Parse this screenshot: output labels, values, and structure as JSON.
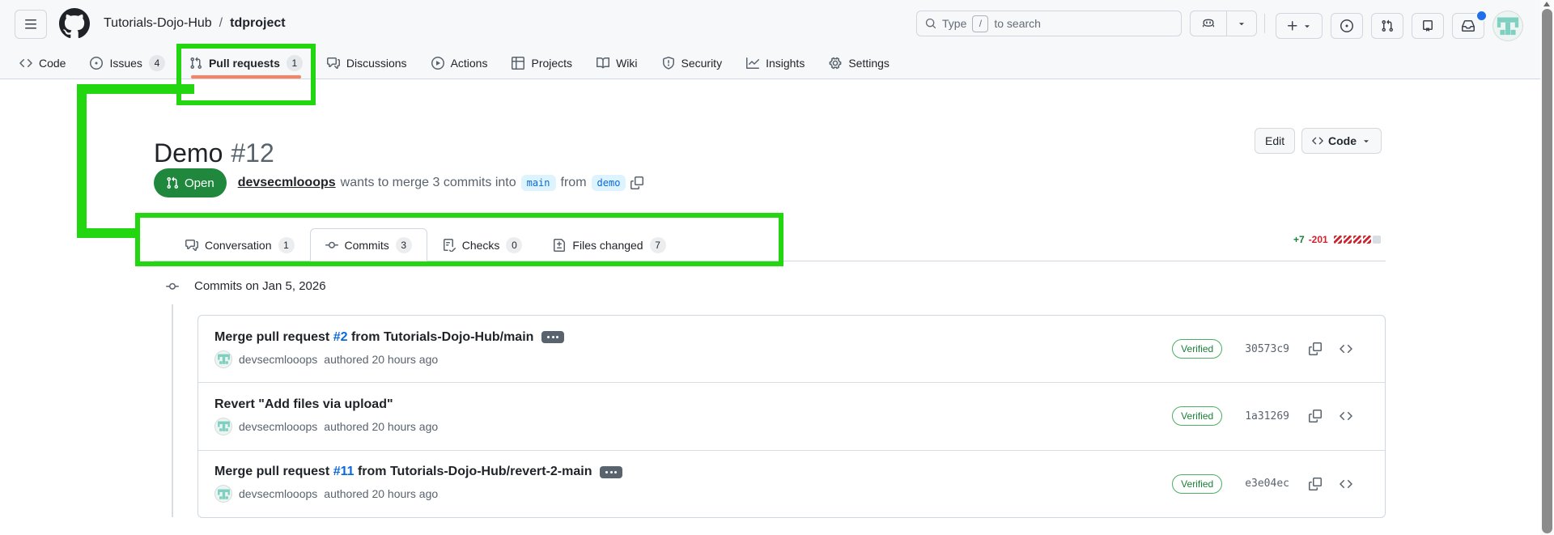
{
  "header": {
    "org": "Tutorials-Dojo-Hub",
    "separator": "/",
    "repo": "tdproject",
    "search_placeholder": {
      "prefix": "Type",
      "key": "/",
      "suffix": "to search"
    }
  },
  "repo_nav": {
    "items": [
      {
        "label": "Code"
      },
      {
        "label": "Issues",
        "count": "4"
      },
      {
        "label": "Pull requests",
        "count": "1",
        "active": true
      },
      {
        "label": "Discussions"
      },
      {
        "label": "Actions"
      },
      {
        "label": "Projects"
      },
      {
        "label": "Wiki"
      },
      {
        "label": "Security"
      },
      {
        "label": "Insights"
      },
      {
        "label": "Settings"
      }
    ]
  },
  "pr_header": {
    "title": "Demo",
    "number": "#12",
    "state": "Open",
    "author": "devsecmlooops",
    "merge_text_1": "wants to merge 3 commits into",
    "base_branch": "main",
    "merge_text_2": "from",
    "head_branch": "demo",
    "edit_button": "Edit",
    "code_button": "Code"
  },
  "pr_tabs": {
    "tabs": [
      {
        "label": "Conversation",
        "count": "1"
      },
      {
        "label": "Commits",
        "count": "3",
        "active": true
      },
      {
        "label": "Checks",
        "count": "0"
      },
      {
        "label": "Files changed",
        "count": "7"
      }
    ],
    "diffstat": {
      "additions": "+7",
      "deletions": "-201",
      "blocks": [
        "deleted",
        "deleted",
        "deleted",
        "deleted",
        "neutral"
      ]
    }
  },
  "commits": {
    "date_header": "Commits on Jan 5, 2026",
    "items": [
      {
        "title_pre": "Merge pull request ",
        "title_link": "#2",
        "title_post": " from Tutorials-Dojo-Hub/main",
        "author": "devsecmlooops",
        "meta": "authored 20 hours ago",
        "badge": "Verified",
        "sha": "30573c9"
      },
      {
        "title_pre": "Revert \"Add files via upload\"",
        "title_link": "",
        "title_post": "",
        "author": "devsecmlooops",
        "meta": "authored 20 hours ago",
        "badge": "Verified",
        "sha": "1a31269"
      },
      {
        "title_pre": "Merge pull request ",
        "title_link": "#11",
        "title_post": " from Tutorials-Dojo-Hub/revert-2-main",
        "author": "devsecmlooops",
        "meta": "authored 20 hours ago",
        "badge": "Verified",
        "sha": "e3e04ec"
      }
    ]
  },
  "colors": {
    "annotation_green": "#22d610",
    "open_badge_green": "#1f883d",
    "active_tab_underline": "#fa8264",
    "additions_green": "#1a7f37",
    "deletions_red": "#d1242f",
    "link_blue": "#0969da",
    "branch_label_bg": "#ddf4ff",
    "verified_green": "#1a7f37",
    "avatar_teal": "#7fd0c1",
    "header_bg": "#f6f8fa",
    "border_gray": "#d0d7de"
  }
}
